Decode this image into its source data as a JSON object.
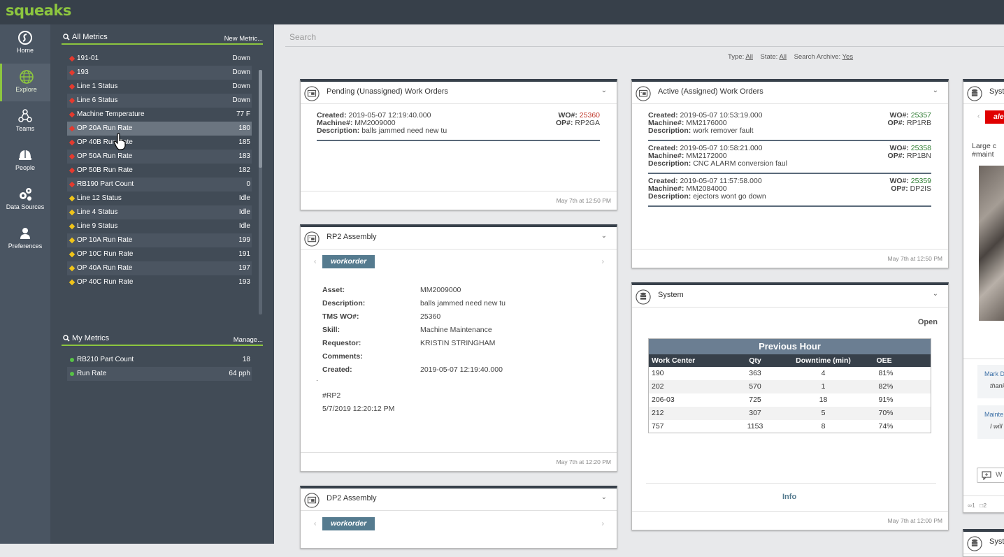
{
  "app": {
    "logo": "squeaks"
  },
  "nav": {
    "items": [
      {
        "label": "Home",
        "icon": "squeaks-logo-icon"
      },
      {
        "label": "Explore",
        "icon": "globe-icon",
        "active": true
      },
      {
        "label": "Teams",
        "icon": "teams-icon"
      },
      {
        "label": "People",
        "icon": "helmet-icon"
      },
      {
        "label": "Data Sources",
        "icon": "gears-icon"
      },
      {
        "label": "Preferences",
        "icon": "user-icon"
      }
    ]
  },
  "all_metrics": {
    "title": "All Metrics",
    "action": "New Metric...",
    "rows": [
      {
        "name": "191-01",
        "value": "Down",
        "status": "red"
      },
      {
        "name": "193",
        "value": "Down",
        "status": "red"
      },
      {
        "name": "Line 1 Status",
        "value": "Down",
        "status": "red"
      },
      {
        "name": "Line 6 Status",
        "value": "Down",
        "status": "red"
      },
      {
        "name": "Machine Temperature",
        "value": "77 F",
        "status": "red"
      },
      {
        "name": "OP 20A Run Rate",
        "value": "180",
        "status": "red"
      },
      {
        "name": "OP 40B Run Rate",
        "value": "185",
        "status": "red"
      },
      {
        "name": "OP 50A Run Rate",
        "value": "183",
        "status": "red"
      },
      {
        "name": "OP 50B Run Rate",
        "value": "182",
        "status": "red"
      },
      {
        "name": "RB190 Part Count",
        "value": "0",
        "status": "red"
      },
      {
        "name": "Line 12 Status",
        "value": "Idle",
        "status": "yellow"
      },
      {
        "name": "Line 4 Status",
        "value": "Idle",
        "status": "yellow"
      },
      {
        "name": "Line 9 Status",
        "value": "Idle",
        "status": "yellow"
      },
      {
        "name": "OP 10A Run Rate",
        "value": "199",
        "status": "yellow"
      },
      {
        "name": "OP 10C Run Rate",
        "value": "191",
        "status": "yellow"
      },
      {
        "name": "OP 40A Run Rate",
        "value": "197",
        "status": "yellow"
      },
      {
        "name": "OP 40C Run Rate",
        "value": "193",
        "status": "yellow"
      }
    ]
  },
  "my_metrics": {
    "title": "My Metrics",
    "action": "Manage...",
    "rows": [
      {
        "name": "RB210 Part Count",
        "value": "18",
        "status": "green"
      },
      {
        "name": "Run Rate",
        "value": "64 pph",
        "status": "green"
      }
    ]
  },
  "search": {
    "placeholder": "Search"
  },
  "filters": {
    "type_label": "Type:",
    "type_value": "All",
    "state_label": "State:",
    "state_value": "All",
    "archive_label": "Search Archive:",
    "archive_value": "Yes"
  },
  "pending": {
    "title": "Pending (Unassigned) Work Orders",
    "footer": "May 7th at 12:50 PM",
    "orders": [
      {
        "created": "2019-05-07 12:19:40.000",
        "machine": "MM2009000",
        "description": "balls jammed need new tu",
        "wo": "25360",
        "op": "RP2GA",
        "wo_color": "#c0392b"
      }
    ]
  },
  "active": {
    "title": "Active (Assigned) Work Orders",
    "footer": "May 7th at 12:50 PM",
    "orders": [
      {
        "created": "2019-05-07 10:53:19.000",
        "machine": "MM2176000",
        "description": "work remover fault",
        "wo": "25357",
        "op": "RP1RB",
        "wo_color": "#2e7d32"
      },
      {
        "created": "2019-05-07 10:58:21.000",
        "machine": "MM2172000",
        "description": "CNC ALARM conversion faul",
        "wo": "25358",
        "op": "RP1BN",
        "wo_color": "#2e7d32"
      },
      {
        "created": "2019-05-07 11:57:58.000",
        "machine": "MM2084000",
        "description": "ejectors wont go down",
        "wo": "25359",
        "op": "DP2IS",
        "wo_color": "#2e7d32"
      }
    ]
  },
  "labels": {
    "created": "Created:",
    "machine": "Machine#:",
    "description": "Description:",
    "wo": "WO#:",
    "op": "OP#:"
  },
  "rp2": {
    "title": "RP2 Assembly",
    "tag": "workorder",
    "fields": [
      {
        "k": "Asset:",
        "v": "MM2009000"
      },
      {
        "k": "Description:",
        "v": "balls jammed need new tu"
      },
      {
        "k": "TMS WO#:",
        "v": "25360"
      },
      {
        "k": "Skill:",
        "v": "Machine Maintenance"
      },
      {
        "k": "Requestor:",
        "v": "KRISTIN STRINGHAM"
      },
      {
        "k": "Comments:",
        "v": ""
      },
      {
        "k": "Created:",
        "v": "2019-05-07 12:19:40.000"
      }
    ],
    "dot": ".",
    "hashtag": "#RP2",
    "timestamp": "5/7/2019 12:20:12 PM",
    "footer": "May 7th at 12:20 PM"
  },
  "dp2": {
    "title": "DP2 Assembly",
    "tag": "workorder"
  },
  "system": {
    "title": "System",
    "open": "Open",
    "table_title": "Previous Hour",
    "columns": [
      "Work Center",
      "Qty",
      "Downtime (min)",
      "OEE"
    ],
    "rows": [
      [
        "190",
        "363",
        "4",
        "81%"
      ],
      [
        "202",
        "570",
        "1",
        "82%"
      ],
      [
        "206-03",
        "725",
        "18",
        "91%"
      ],
      [
        "212",
        "307",
        "5",
        "70%"
      ],
      [
        "757",
        "1153",
        "8",
        "74%"
      ]
    ],
    "info": "Info",
    "footer": "May 7th at 12:00 PM"
  },
  "partial": {
    "title": "Syst",
    "badge": "ale",
    "text1": "Large c",
    "text2": "#maint",
    "comment1_name": "Mark D",
    "comment1_text": "thank",
    "comment2_name": "Mainte",
    "comment2_text": "I will",
    "reply": "W",
    "stats_links": "1",
    "stats_comments": "2",
    "bottom_title": "Syst"
  }
}
